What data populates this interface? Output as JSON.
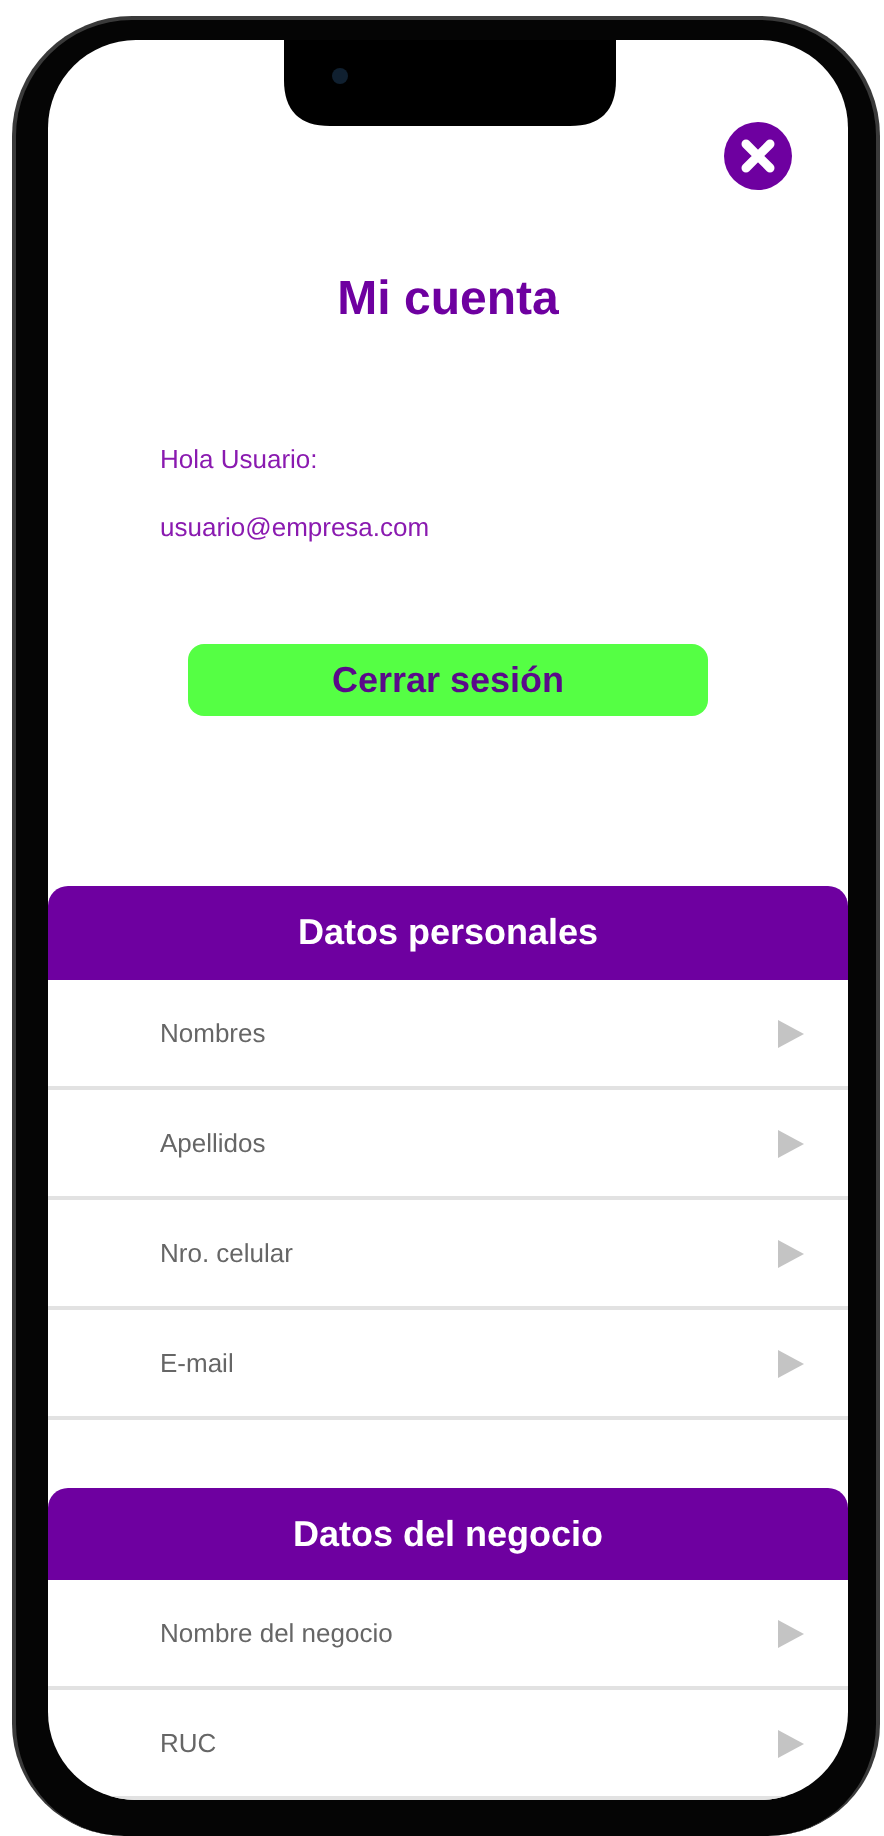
{
  "title": "Mi cuenta",
  "greeting": "Hola Usuario:",
  "email": "usuario@empresa.com",
  "logout_button": "Cerrar sesión",
  "sections": [
    {
      "title": "Datos personales",
      "items": [
        {
          "label": "Nombres"
        },
        {
          "label": "Apellidos"
        },
        {
          "label": "Nro. celular"
        },
        {
          "label": "E-mail"
        }
      ]
    },
    {
      "title": "Datos del negocio",
      "items": [
        {
          "label": "Nombre del negocio"
        },
        {
          "label": "RUC"
        }
      ]
    }
  ]
}
